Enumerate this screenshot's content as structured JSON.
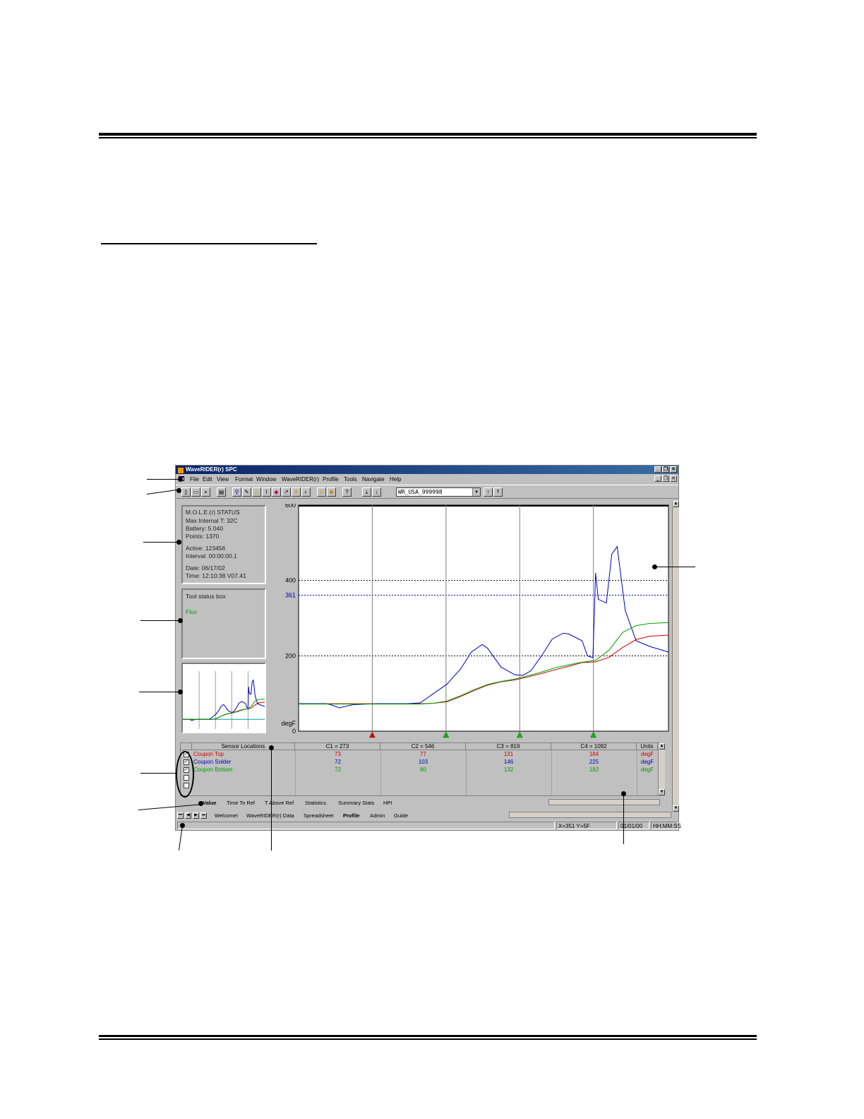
{
  "window": {
    "title": "WaveRIDER(r) SPC",
    "minimize_glyph": "_",
    "restore_glyph": "❐",
    "close_glyph": "✕"
  },
  "menu": [
    "File",
    "Edit",
    "View",
    "Format",
    "Window",
    "WaveRIDER(r)",
    "Profile",
    "Tools",
    "Navigate",
    "Help"
  ],
  "toolbar": {
    "combo_value": "WR_USA_999998",
    "combo_arrow": "▼"
  },
  "status_panel": {
    "heading": "M.O.L.E.(r) STATUS",
    "max_internal": "Max Internal T: 32C",
    "battery": "Battery: 5.040",
    "points": "Points: 1370",
    "active": "Active: 123456",
    "interval": "Interval: 00:00:00.1",
    "date": "Date: 06/17/02",
    "time": "Time: 12:10:38  V07.41"
  },
  "tool_status": {
    "heading": "Tool status box",
    "item": "Flux"
  },
  "chart_data": {
    "type": "line",
    "ylim": [
      0,
      600
    ],
    "y_ticks": [
      "600",
      "400",
      "200",
      "0"
    ],
    "ylabel": "degF",
    "reference_lines": [
      {
        "label": "",
        "value": 400,
        "color": "#000000"
      },
      {
        "label": "361",
        "value": 361,
        "color": "#0000c0"
      },
      {
        "label": "",
        "value": 200,
        "color": "#000000"
      }
    ],
    "xlim": [
      0,
      1370
    ],
    "cursor_markers": [
      {
        "x": 273,
        "color": "#e00000"
      },
      {
        "x": 546,
        "color": "#00c000"
      },
      {
        "x": 819,
        "color": "#00c000"
      },
      {
        "x": 1092,
        "color": "#00c000"
      }
    ],
    "series": [
      {
        "name": "Coupon Top",
        "color": "#d00000",
        "x": [
          0,
          100,
          200,
          300,
          400,
          450,
          500,
          550,
          600,
          650,
          700,
          750,
          800,
          850,
          900,
          950,
          1000,
          1050,
          1100,
          1150,
          1200,
          1250,
          1300,
          1370
        ],
        "y": [
          73,
          73,
          73,
          73,
          73,
          73,
          74,
          78,
          92,
          108,
          122,
          131,
          136,
          144,
          153,
          163,
          172,
          182,
          184,
          196,
          222,
          243,
          252,
          255
        ]
      },
      {
        "name": "Coupon Solder",
        "color": "#0000c0",
        "x": [
          0,
          100,
          120,
          150,
          200,
          250,
          300,
          400,
          450,
          500,
          550,
          600,
          640,
          680,
          700,
          750,
          800,
          830,
          860,
          900,
          940,
          980,
          1000,
          1050,
          1070,
          1090,
          1095,
          1100,
          1110,
          1140,
          1160,
          1180,
          1210,
          1250,
          1300,
          1370
        ],
        "y": [
          73,
          73,
          70,
          62,
          70,
          72,
          73,
          73,
          75,
          100,
          125,
          165,
          210,
          230,
          220,
          170,
          150,
          148,
          160,
          200,
          245,
          260,
          258,
          240,
          200,
          195,
          300,
          420,
          350,
          340,
          470,
          490,
          320,
          240,
          225,
          210
        ]
      },
      {
        "name": "Coupon Bottom",
        "color": "#00a000",
        "x": [
          0,
          100,
          200,
          300,
          400,
          450,
          500,
          550,
          600,
          650,
          700,
          750,
          800,
          850,
          900,
          950,
          1000,
          1050,
          1100,
          1150,
          1200,
          1250,
          1300,
          1370
        ],
        "y": [
          72,
          72,
          72,
          72,
          72,
          72,
          74,
          80,
          94,
          110,
          124,
          132,
          138,
          147,
          157,
          168,
          176,
          183,
          188,
          215,
          262,
          280,
          286,
          288
        ]
      }
    ]
  },
  "table": {
    "headers": [
      "Sensor Locations",
      "C1 = 273",
      "C2 = 546",
      "C3 = 819",
      "C4 = 1092",
      "Units"
    ],
    "rows": [
      {
        "name": "Coupon Top",
        "c1": "73",
        "c2": "77",
        "c3": "131",
        "c4": "184",
        "unit": "degF",
        "color": "#d00000",
        "checked": "✓"
      },
      {
        "name": "Coupon Solder",
        "c1": "72",
        "c2": "103",
        "c3": "146",
        "c4": "225",
        "unit": "degF",
        "color": "#0000c0",
        "checked": "✓"
      },
      {
        "name": "Coupon Bottom",
        "c1": "72",
        "c2": "80",
        "c3": "132",
        "c4": "182",
        "unit": "degF",
        "color": "#00a000",
        "checked": "✓"
      }
    ]
  },
  "data_tabs": [
    "Value",
    "Time To Ref",
    "T Above Ref",
    "Statistics",
    "Summary Stats",
    "HPI"
  ],
  "sheet_tabs": [
    "Welcome!",
    "WaveRIDER(r) Data",
    "Spreadsheet",
    "Profile",
    "Admin",
    "Guide"
  ],
  "statusbar": {
    "coords": "X=351 Y=5F",
    "date": "01/01/00",
    "time": "HH:MM:SS"
  }
}
